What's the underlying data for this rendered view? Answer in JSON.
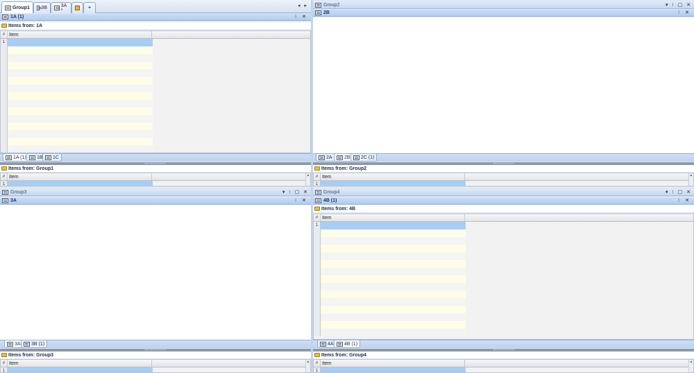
{
  "top_tabs": [
    {
      "label": "Group1",
      "active": true
    },
    {
      "label": "3B",
      "active": false
    },
    {
      "label": "3A *",
      "active": false
    }
  ],
  "top_tabs_extra": {
    "home_icon": "home-icon",
    "add_label": "+",
    "scroll_arrows": "◂ ▸"
  },
  "items_from_label": "Items from:",
  "grid_header": {
    "hash": "#",
    "item": "Item"
  },
  "row_number": "1",
  "ctrl_glyphs": {
    "group": "▾ ⁝ ▢ ✕",
    "doc": "⁝ ✕"
  },
  "group1": {
    "doc_title": "1A (1)",
    "items_source": "1A",
    "subtabs": [
      "1A (1)",
      "1B",
      "1C"
    ],
    "footer_source": "Group1"
  },
  "group2": {
    "group_title": "Group2",
    "doc_title": "2B",
    "subtabs": [
      "2A",
      "2B",
      "2C (1)"
    ],
    "footer_source": "Group2"
  },
  "group3": {
    "group_title": "Group3",
    "doc_title": "3A",
    "subtabs": [
      "3A",
      "3B (1)"
    ],
    "footer_source": "Group3"
  },
  "group4": {
    "group_title": "Group4",
    "doc_title": "4B (1)",
    "items_source": "4B",
    "subtabs": [
      "4A",
      "4B (1)"
    ],
    "footer_source": "Group4"
  },
  "colors": {
    "row_selected": "#a8cdf5",
    "row_alt": "#fefde8",
    "row_plain": "#f4f4f4",
    "accent": "#c5d8f0"
  }
}
